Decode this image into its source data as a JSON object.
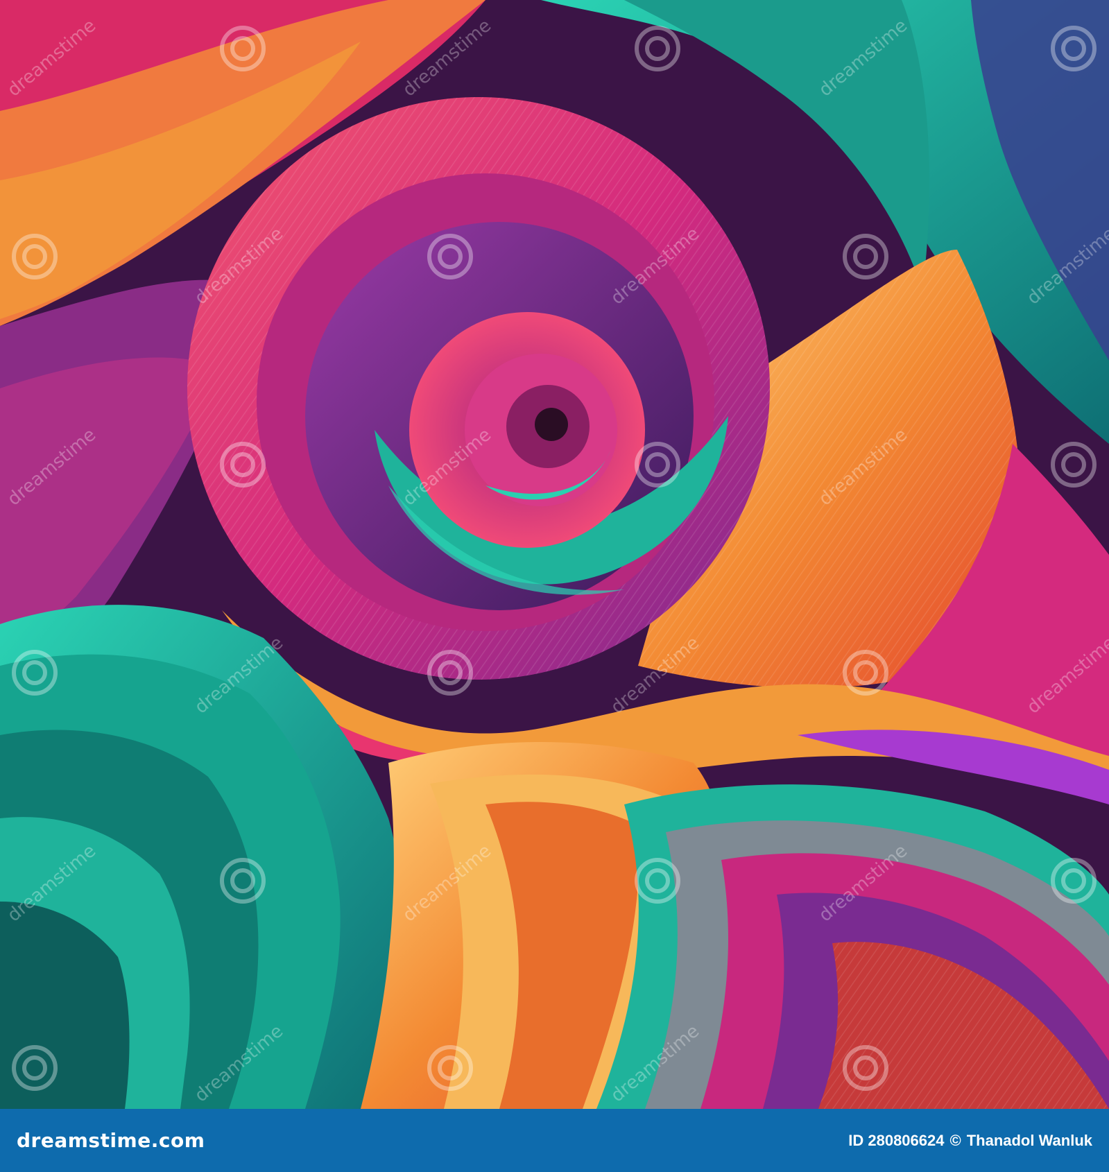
{
  "image": {
    "palette": {
      "pink": "#e8356f",
      "magenta": "#c1278a",
      "purple": "#6b2a8f",
      "teal": "#1fb39b",
      "orange": "#f28a2e",
      "yellow": "#f7b85a",
      "footer_bar": "#0e6bad"
    },
    "watermark": {
      "text": "dreamstime",
      "icon": "spiral-icon"
    }
  },
  "footer": {
    "logo": "dreamstime.com",
    "id_label": "ID 280806624",
    "copyright_symbol": "©",
    "author": "Thanadol Wanluk"
  }
}
